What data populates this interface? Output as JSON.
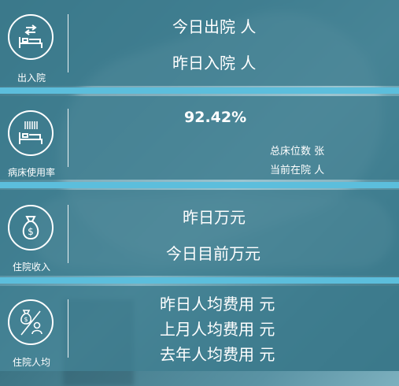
{
  "admission": {
    "label": "出入院",
    "icon": "bed-transfer-icon",
    "today_discharge": "今日出院 人",
    "yesterday_admission": "昨日入院 人"
  },
  "occupancy": {
    "label": "病床使用率",
    "icon": "bed-usage-icon",
    "rate": "92.42%",
    "total_beds": "总床位数 张",
    "current_inpatients": "当前在院 人"
  },
  "income": {
    "label": "住院收入",
    "icon": "money-bag-icon",
    "yesterday": "昨日万元",
    "today": "今日目前万元"
  },
  "per_capita": {
    "label": "住院人均",
    "icon": "money-per-person-icon",
    "yesterday": "昨日人均费用 元",
    "last_month": "上月人均费用 元",
    "last_year": "去年人均费用 元"
  },
  "colors": {
    "panel": "#3a7a8c",
    "separator": "#5cbedc",
    "text": "#ffffff"
  }
}
